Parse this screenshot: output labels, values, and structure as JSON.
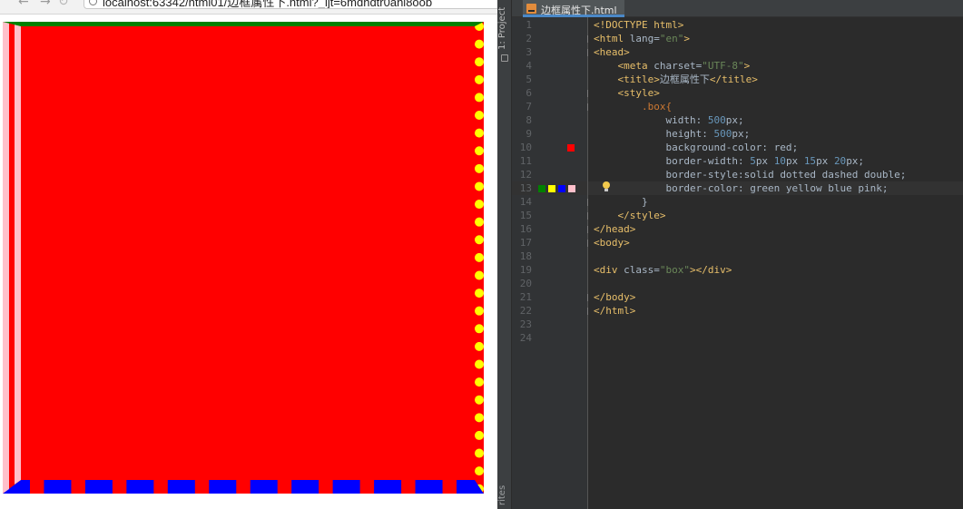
{
  "browser": {
    "url_text": "localhost:63342/html01/边框属性下.html?_ijt=6mdhdtr0ahl8oob",
    "box": {
      "background_color": "red",
      "border_width": "5px 10px 15px 20px",
      "border_style": "solid dotted dashed double",
      "border_color": "green yellow blue pink"
    }
  },
  "ide": {
    "sidebar": {
      "project_label": "1: Project",
      "favorites_label": "rites"
    },
    "tab": {
      "label": "边框属性下.html",
      "icon": "html-file-icon"
    },
    "current_line": 13,
    "swatch_colors": [
      "#008000",
      "#ffff00",
      "#0000ff",
      "#ffc0cb"
    ],
    "line10_swatch": "#ff0000",
    "lines": [
      {
        "no": "1",
        "segments": [
          {
            "t": "<!DOCTYPE html>",
            "c": "kw"
          }
        ]
      },
      {
        "no": "2",
        "segments": [
          {
            "t": "<html ",
            "c": "kw"
          },
          {
            "t": "lang=",
            "c": "txt"
          },
          {
            "t": "\"en\"",
            "c": "str"
          },
          {
            "t": ">",
            "c": "kw"
          }
        ]
      },
      {
        "no": "3",
        "segments": [
          {
            "t": "<head>",
            "c": "kw"
          }
        ]
      },
      {
        "no": "4",
        "segments": [
          {
            "t": "    <meta ",
            "c": "kw"
          },
          {
            "t": "charset=",
            "c": "txt"
          },
          {
            "t": "\"UTF-8\"",
            "c": "str"
          },
          {
            "t": ">",
            "c": "kw"
          }
        ]
      },
      {
        "no": "5",
        "segments": [
          {
            "t": "    <title>",
            "c": "kw"
          },
          {
            "t": "边框属性下",
            "c": "txt"
          },
          {
            "t": "</title>",
            "c": "kw"
          }
        ]
      },
      {
        "no": "6",
        "segments": [
          {
            "t": "    <style>",
            "c": "kw"
          }
        ]
      },
      {
        "no": "7",
        "segments": [
          {
            "t": "        .box{",
            "c": "sel"
          }
        ]
      },
      {
        "no": "8",
        "segments": [
          {
            "t": "            width: ",
            "c": "txt"
          },
          {
            "t": "500",
            "c": "num"
          },
          {
            "t": "px;",
            "c": "txt"
          }
        ]
      },
      {
        "no": "9",
        "segments": [
          {
            "t": "            height: ",
            "c": "txt"
          },
          {
            "t": "500",
            "c": "num"
          },
          {
            "t": "px;",
            "c": "txt"
          }
        ]
      },
      {
        "no": "10",
        "segments": [
          {
            "t": "            background-color: ",
            "c": "txt"
          },
          {
            "t": "red",
            "c": "txt"
          },
          {
            "t": ";",
            "c": "txt"
          }
        ]
      },
      {
        "no": "11",
        "segments": [
          {
            "t": "            border-width: ",
            "c": "txt"
          },
          {
            "t": "5",
            "c": "num"
          },
          {
            "t": "px ",
            "c": "txt"
          },
          {
            "t": "10",
            "c": "num"
          },
          {
            "t": "px ",
            "c": "txt"
          },
          {
            "t": "15",
            "c": "num"
          },
          {
            "t": "px ",
            "c": "txt"
          },
          {
            "t": "20",
            "c": "num"
          },
          {
            "t": "px;",
            "c": "txt"
          }
        ]
      },
      {
        "no": "12",
        "segments": [
          {
            "t": "            border-style:",
            "c": "txt"
          },
          {
            "t": "solid dotted dashed double;",
            "c": "txt"
          }
        ]
      },
      {
        "no": "13",
        "segments": [
          {
            "t": "            border-color: ",
            "c": "txt"
          },
          {
            "t": "green yellow blue pink;",
            "c": "txt"
          }
        ]
      },
      {
        "no": "14",
        "segments": [
          {
            "t": "        }",
            "c": "txt"
          }
        ]
      },
      {
        "no": "15",
        "segments": [
          {
            "t": "    </style>",
            "c": "kw"
          }
        ]
      },
      {
        "no": "16",
        "segments": [
          {
            "t": "</head>",
            "c": "kw"
          }
        ]
      },
      {
        "no": "17",
        "segments": [
          {
            "t": "<body>",
            "c": "kw"
          }
        ]
      },
      {
        "no": "18",
        "segments": []
      },
      {
        "no": "19",
        "segments": [
          {
            "t": "<div ",
            "c": "kw"
          },
          {
            "t": "class=",
            "c": "txt"
          },
          {
            "t": "\"box\"",
            "c": "str"
          },
          {
            "t": "></div>",
            "c": "kw"
          }
        ]
      },
      {
        "no": "20",
        "segments": []
      },
      {
        "no": "21",
        "segments": [
          {
            "t": "</body>",
            "c": "kw"
          }
        ]
      },
      {
        "no": "22",
        "segments": [
          {
            "t": "</html>",
            "c": "kw"
          }
        ]
      },
      {
        "no": "23",
        "segments": []
      },
      {
        "no": "24",
        "segments": []
      }
    ]
  }
}
